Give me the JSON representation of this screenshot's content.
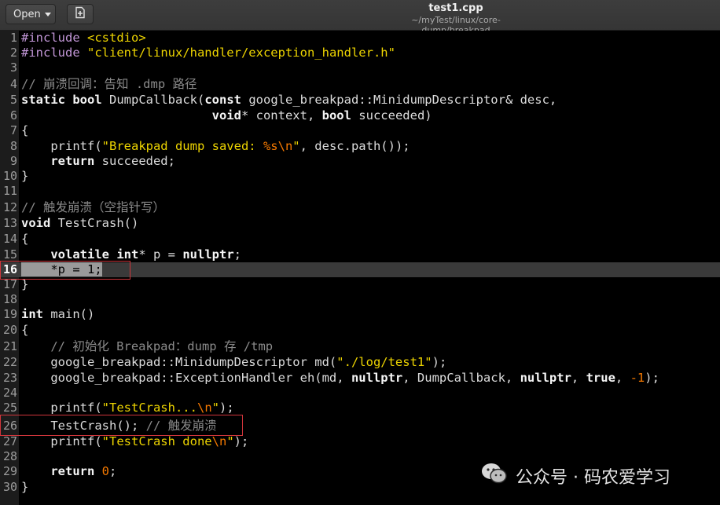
{
  "header": {
    "open_label": "Open",
    "title": "test1.cpp",
    "subtitle": "~/myTest/linux/core-dump/breakpad"
  },
  "icons": {
    "open_caret": "chevron-down-icon",
    "new_document": "new-document-icon",
    "watermark": "wechat-icon"
  },
  "colors": {
    "background": "#000000",
    "keyword": "#f5f5f5",
    "string": "#edd400",
    "comment": "#8a8a8a",
    "number": "#f57900",
    "highlight_box": "#d0353b"
  },
  "editor": {
    "current_line": 16,
    "lines": [
      {
        "n": "1",
        "segs": [
          [
            "pp",
            "#include "
          ],
          [
            "str",
            "<cstdio>"
          ]
        ]
      },
      {
        "n": "2",
        "segs": [
          [
            "pp",
            "#include "
          ],
          [
            "str",
            "\"client/linux/handler/exception_handler.h\""
          ]
        ]
      },
      {
        "n": "3",
        "segs": []
      },
      {
        "n": "4",
        "segs": [
          [
            "cm",
            "// 崩溃回调：告知 .dmp 路径"
          ]
        ]
      },
      {
        "n": "5",
        "segs": [
          [
            "kw",
            "static "
          ],
          [
            "kw",
            "bool "
          ],
          [
            "",
            "DumpCallback("
          ],
          [
            "kw",
            "const "
          ],
          [
            "",
            "google_breakpad::MinidumpDescriptor& desc,"
          ]
        ]
      },
      {
        "n": "6",
        "segs": [
          [
            "",
            "                          "
          ],
          [
            "kw",
            "void"
          ],
          [
            "",
            "* context, "
          ],
          [
            "kw",
            "bool "
          ],
          [
            "",
            "succeeded)"
          ]
        ]
      },
      {
        "n": "7",
        "segs": [
          [
            "",
            "{"
          ]
        ]
      },
      {
        "n": "8",
        "segs": [
          [
            "",
            "    printf("
          ],
          [
            "str",
            "\"Breakpad dump saved: "
          ],
          [
            "esc",
            "%s\\n"
          ],
          [
            "str",
            "\""
          ],
          [
            "",
            ", desc.path());"
          ]
        ]
      },
      {
        "n": "9",
        "segs": [
          [
            "",
            "    "
          ],
          [
            "kw",
            "return "
          ],
          [
            "",
            "succeeded;"
          ]
        ]
      },
      {
        "n": "10",
        "segs": [
          [
            "",
            "}"
          ]
        ]
      },
      {
        "n": "11",
        "segs": []
      },
      {
        "n": "12",
        "segs": [
          [
            "cm",
            "// 触发崩溃（空指针写）"
          ]
        ]
      },
      {
        "n": "13",
        "segs": [
          [
            "kw",
            "void "
          ],
          [
            "",
            "TestCrash()"
          ]
        ]
      },
      {
        "n": "14",
        "segs": [
          [
            "",
            "{"
          ]
        ]
      },
      {
        "n": "15",
        "segs": [
          [
            "",
            "    "
          ],
          [
            "kw",
            "volatile "
          ],
          [
            "kw",
            "int"
          ],
          [
            "",
            "* p = "
          ],
          [
            "kw",
            "nullptr"
          ],
          [
            "",
            ";"
          ]
        ]
      },
      {
        "n": "16",
        "segs": [
          [
            "sel",
            "    *p = 1;"
          ]
        ]
      },
      {
        "n": "17",
        "segs": [
          [
            "",
            "}"
          ]
        ]
      },
      {
        "n": "18",
        "segs": []
      },
      {
        "n": "19",
        "segs": [
          [
            "kw",
            "int "
          ],
          [
            "",
            "main()"
          ]
        ]
      },
      {
        "n": "20",
        "segs": [
          [
            "",
            "{"
          ]
        ]
      },
      {
        "n": "21",
        "segs": [
          [
            "",
            "    "
          ],
          [
            "cm",
            "// 初始化 Breakpad：dump 存 /tmp"
          ]
        ]
      },
      {
        "n": "22",
        "segs": [
          [
            "",
            "    google_breakpad::MinidumpDescriptor md("
          ],
          [
            "str",
            "\"./log/test1\""
          ],
          [
            "",
            ");"
          ]
        ]
      },
      {
        "n": "23",
        "segs": [
          [
            "",
            "    google_breakpad::ExceptionHandler eh(md, "
          ],
          [
            "kw",
            "nullptr"
          ],
          [
            "",
            ", DumpCallback, "
          ],
          [
            "kw",
            "nullptr"
          ],
          [
            "",
            ", "
          ],
          [
            "kw",
            "true"
          ],
          [
            "",
            ", "
          ],
          [
            "num",
            "-1"
          ],
          [
            "",
            ");"
          ]
        ]
      },
      {
        "n": "24",
        "segs": []
      },
      {
        "n": "25",
        "segs": [
          [
            "",
            "    printf("
          ],
          [
            "str",
            "\"TestCrash..."
          ],
          [
            "esc",
            "\\n"
          ],
          [
            "str",
            "\""
          ],
          [
            "",
            ");"
          ]
        ]
      },
      {
        "n": "26",
        "segs": [
          [
            "",
            "    TestCrash(); "
          ],
          [
            "cm",
            "// 触发崩溃"
          ]
        ]
      },
      {
        "n": "27",
        "segs": [
          [
            "",
            "    printf("
          ],
          [
            "str",
            "\"TestCrash done"
          ],
          [
            "esc",
            "\\n"
          ],
          [
            "str",
            "\""
          ],
          [
            "",
            ");"
          ]
        ]
      },
      {
        "n": "28",
        "segs": []
      },
      {
        "n": "29",
        "segs": [
          [
            "",
            "    "
          ],
          [
            "kw",
            "return "
          ],
          [
            "num",
            "0"
          ],
          [
            "",
            ";"
          ]
        ]
      },
      {
        "n": "30",
        "segs": [
          [
            "",
            "}"
          ]
        ]
      }
    ]
  },
  "watermark": {
    "text": "公众号 · 码农爱学习"
  }
}
